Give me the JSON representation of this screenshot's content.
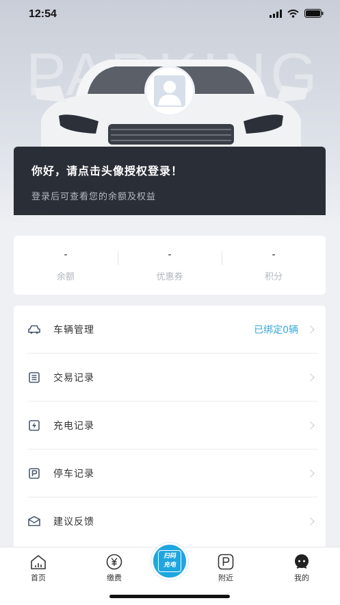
{
  "status_bar": {
    "time": "12:54"
  },
  "hero": {
    "watermark": "PARKING",
    "login_title": "你好，请点击头像授权登录！",
    "login_subtitle": "登录后可查看您的余额及权益"
  },
  "stats": [
    {
      "value": "-",
      "label": "余额"
    },
    {
      "value": "-",
      "label": "优惠券"
    },
    {
      "value": "-",
      "label": "积分"
    }
  ],
  "menu": [
    {
      "label": "车辆管理",
      "extra": "已绑定0辆",
      "icon": "car-icon"
    },
    {
      "label": "交易记录",
      "extra": "",
      "icon": "list-icon"
    },
    {
      "label": "充电记录",
      "extra": "",
      "icon": "charge-icon"
    },
    {
      "label": "停车记录",
      "extra": "",
      "icon": "parking-icon"
    },
    {
      "label": "建议反馈",
      "extra": "",
      "icon": "feedback-icon"
    }
  ],
  "tabbar": {
    "home": "首页",
    "pay": "缴费",
    "scan_line1": "扫码",
    "scan_line2": "充电",
    "nearby": "附近",
    "mine": "我的"
  },
  "colors": {
    "accent": "#1ea6e0",
    "link": "#3aa7d8",
    "dark_card": "#2a2e36"
  }
}
